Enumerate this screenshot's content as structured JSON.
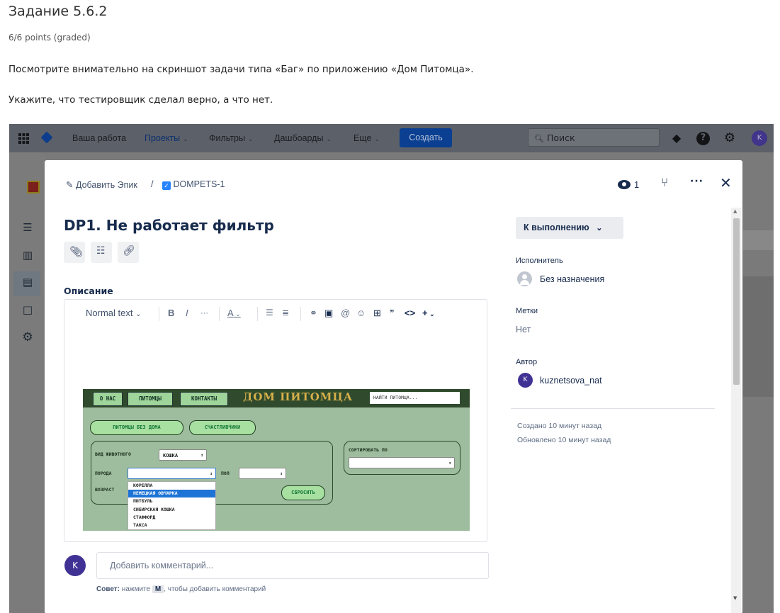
{
  "task": {
    "title": "Задание 5.6.2",
    "points": "6/6 points (graded)",
    "p1": "Посмотрите внимательно на скриншот задачи типа «Баг» по приложению «Дом Питомца».",
    "p2": "Укажите, что тестировщик сделал верно, а что нет."
  },
  "jira": {
    "nav": {
      "your_work": "Ваша работа",
      "projects": "Проекты",
      "filters": "Фильтры",
      "dashboards": "Дашбоарды",
      "more": "Еще",
      "create": "Создать",
      "search_placeholder": "Поиск",
      "user_initial": "K"
    },
    "modal": {
      "breadcrumb_epic": "Добавить Эпик",
      "breadcrumb_sep": "/",
      "issue_key": "DOMPETS-1",
      "watchers": "1",
      "title": "DP1. Не работает фильтр",
      "description_label": "Описание",
      "toolbar": {
        "text_style": "Normal text",
        "bold": "B",
        "italic": "I",
        "more": "···",
        "color": "A",
        "insert": "+"
      },
      "comment_placeholder": "Добавить комментарий...",
      "hint_prefix": "Совет:",
      "hint_text": " нажмите ",
      "hint_key": "M",
      "hint_suffix": ", чтобы добавить комментарий",
      "commenter_initial": "K"
    },
    "side": {
      "status": "К выполнению",
      "assignee_label": "Исполнитель",
      "assignee_value": "Без назначения",
      "labels_label": "Метки",
      "labels_value": "Нет",
      "reporter_label": "Автор",
      "reporter_value": "kuznetsova_nat",
      "reporter_initial": "K",
      "created": "Создано 10 минут назад",
      "updated": "Обновлено 10 минут назад"
    }
  },
  "app_screenshot": {
    "nav_about": "О НАС",
    "nav_pets": "ПИТОМЦЫ",
    "nav_contacts": "КОНТАКТЫ",
    "logo": "ДОМ ПИТОМЦА",
    "search_placeholder": "НАЙТИ ПИТОМЦА...",
    "tab_homeless": "ПИТОМЦЫ БЕЗ ДОМА",
    "tab_lucky": "СЧАСТЛИВЧИКИ",
    "label_animal": "ВИД ЖИВОТНОГО",
    "animal_value": "КОШКА",
    "label_breed": "ПОРОДА",
    "label_sex": "ПОЛ",
    "label_age": "ВОЗРАСТ",
    "label_sort": "СОРТИРОВАТЬ ПО",
    "reset": "СБРОСИТЬ",
    "breeds": [
      "КОРЕЛЛА",
      "НЕМЕЦКАЯ ОВЧАРКА",
      "ПИТБУЛЬ",
      "СИБИРСКАЯ КОШКА",
      "СТАФФОРД",
      "ТАКСА"
    ],
    "highlighted_breed_index": 1
  }
}
